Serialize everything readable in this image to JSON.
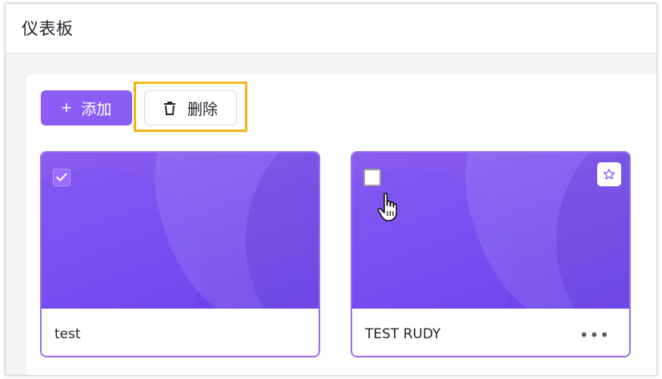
{
  "page": {
    "title": "仪表板"
  },
  "toolbar": {
    "add_label": "添加",
    "add_icon": "plus-icon",
    "delete_label": "删除",
    "delete_icon": "trash-icon"
  },
  "cards": [
    {
      "title": "test",
      "selected": true
    },
    {
      "title": "TEST RUDY",
      "selected": false,
      "star_icon": "star-icon",
      "more_icon": "more-horizontal-icon"
    }
  ],
  "colors": {
    "accent": "#8b5cf6",
    "highlight": "#f0b81a",
    "card_border": "#9b6ef0"
  }
}
